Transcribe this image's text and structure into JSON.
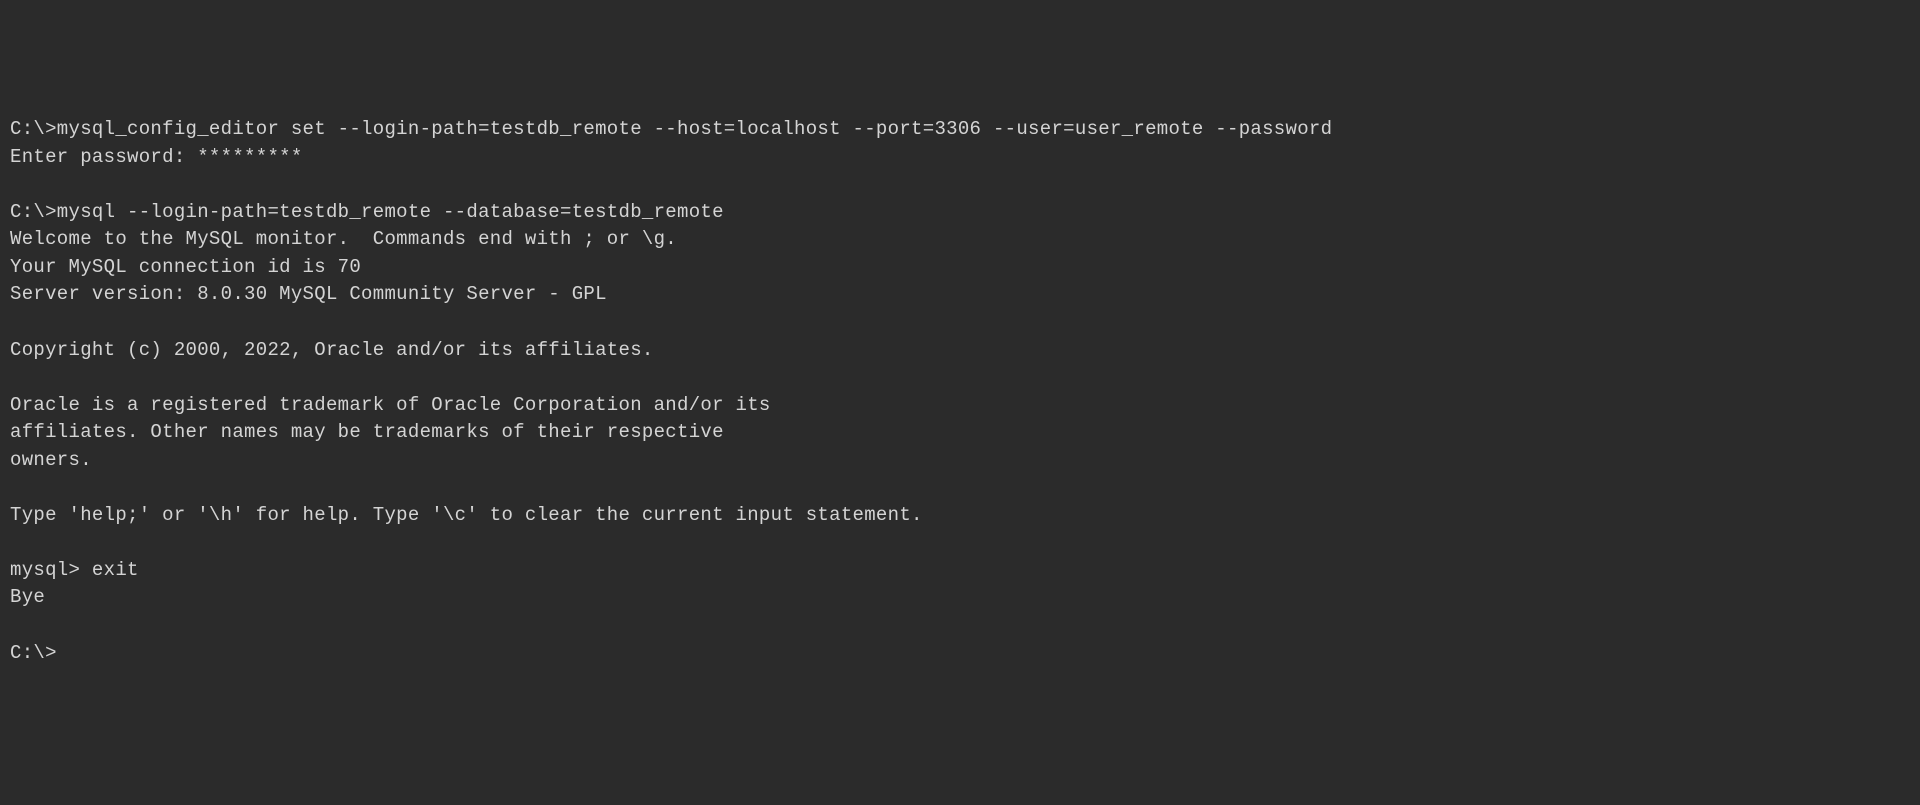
{
  "terminal": {
    "lines": [
      "C:\\>mysql_config_editor set --login-path=testdb_remote --host=localhost --port=3306 --user=user_remote --password",
      "Enter password: *********",
      "",
      "C:\\>mysql --login-path=testdb_remote --database=testdb_remote",
      "Welcome to the MySQL monitor.  Commands end with ; or \\g.",
      "Your MySQL connection id is 70",
      "Server version: 8.0.30 MySQL Community Server - GPL",
      "",
      "Copyright (c) 2000, 2022, Oracle and/or its affiliates.",
      "",
      "Oracle is a registered trademark of Oracle Corporation and/or its",
      "affiliates. Other names may be trademarks of their respective",
      "owners.",
      "",
      "Type 'help;' or '\\h' for help. Type '\\c' to clear the current input statement.",
      "",
      "mysql> exit",
      "Bye",
      "",
      "C:\\>"
    ]
  }
}
